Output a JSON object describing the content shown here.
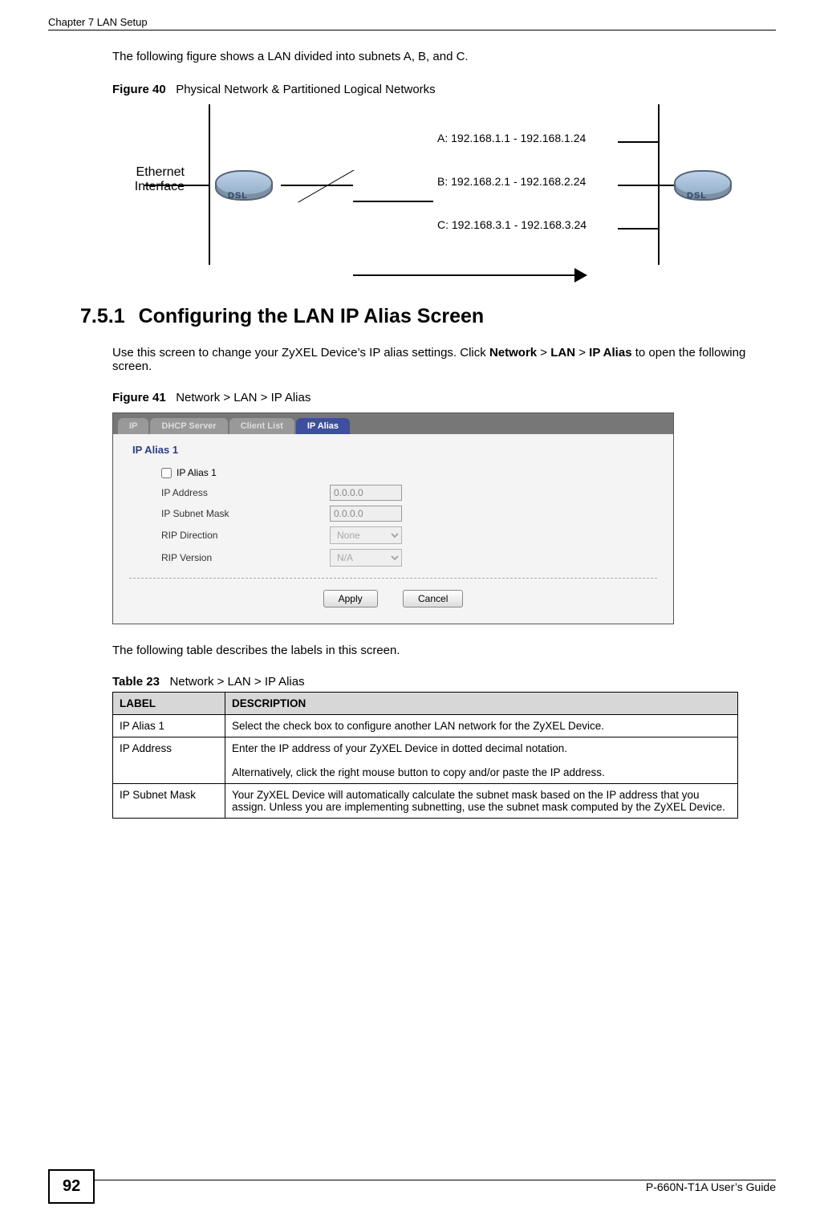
{
  "header": {
    "chapter": "Chapter 7 LAN Setup"
  },
  "intro": "The following figure shows a LAN divided into subnets A, B, and C.",
  "figure40": {
    "label": "Figure 40",
    "title": "Physical Network & Partitioned Logical Networks",
    "ethernet_label_line1": "Ethernet",
    "ethernet_label_line2": "Interface",
    "dsl": "DSL",
    "subnetA": "A: 192.168.1.1 - 192.168.1.24",
    "subnetB": "B: 192.168.2.1 - 192.168.2.24",
    "subnetC": "C: 192.168.3.1 - 192.168.3.24"
  },
  "section": {
    "number": "7.5.1",
    "title": "Configuring the LAN IP Alias Screen"
  },
  "paragraph1_a": "Use this screen to change your ZyXEL Device’s IP alias settings. Click ",
  "paragraph1_b": "Network",
  "paragraph1_c": " > ",
  "paragraph1_d": "LAN",
  "paragraph1_e": " > ",
  "paragraph1_f": "IP Alias",
  "paragraph1_g": " to open the following screen.",
  "figure41": {
    "label": "Figure 41",
    "title": "Network > LAN > IP Alias"
  },
  "ui": {
    "tabs": [
      "IP",
      "DHCP Server",
      "Client List",
      "IP Alias"
    ],
    "active_tab_index": 3,
    "panel_title": "IP Alias 1",
    "checkbox_label": "IP Alias 1",
    "rows": {
      "ip_address_label": "IP Address",
      "ip_address_value": "0.0.0.0",
      "subnet_label": "IP Subnet Mask",
      "subnet_value": "0.0.0.0",
      "rip_dir_label": "RIP Direction",
      "rip_dir_value": "None",
      "rip_ver_label": "RIP Version",
      "rip_ver_value": "N/A"
    },
    "buttons": {
      "apply": "Apply",
      "cancel": "Cancel"
    }
  },
  "after_fig_para": "The following table describes the labels in this screen.",
  "table23": {
    "label": "Table 23",
    "title": "Network > LAN > IP Alias",
    "head_label": "LABEL",
    "head_desc": "DESCRIPTION",
    "rows": [
      {
        "label": "IP Alias 1",
        "desc": "Select the check box to configure another LAN network for the ZyXEL Device."
      },
      {
        "label": "IP Address",
        "desc": "Enter the IP address of your ZyXEL Device in dotted decimal notation.\n\nAlternatively, click the right mouse button to copy and/or paste the IP address."
      },
      {
        "label": "IP Subnet Mask",
        "desc": "Your ZyXEL Device will automatically calculate the subnet mask based on the IP address that you assign. Unless you are implementing subnetting, use the subnet mask computed by the ZyXEL Device."
      }
    ]
  },
  "footer": {
    "page": "92",
    "guide": "P-660N-T1A User’s Guide"
  }
}
